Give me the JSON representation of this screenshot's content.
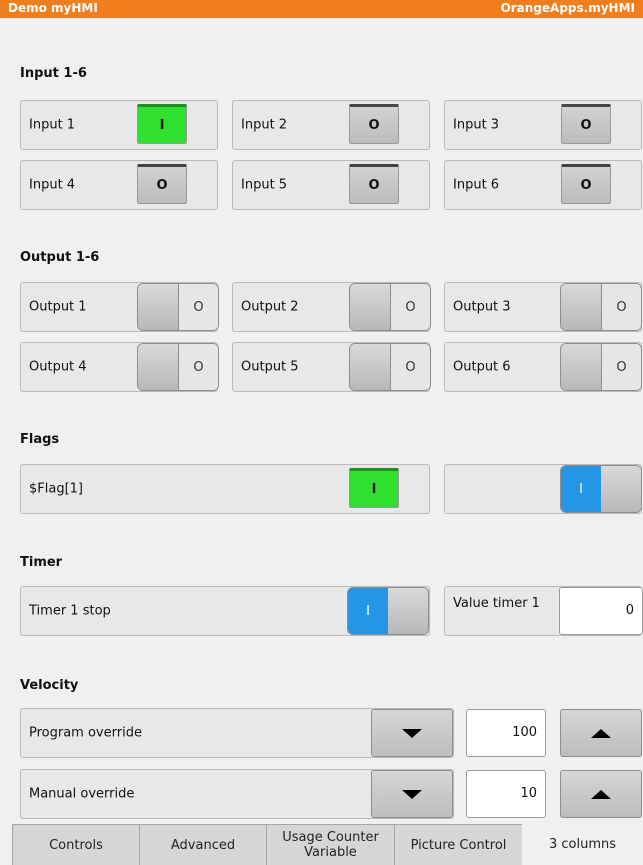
{
  "header": {
    "app_title": "Demo myHMI",
    "brand": "OrangeApps.myHMI"
  },
  "inputs": {
    "title": "Input 1-6",
    "items": [
      {
        "label": "Input 1",
        "state": "I"
      },
      {
        "label": "Input 2",
        "state": "O"
      },
      {
        "label": "Input 3",
        "state": "O"
      },
      {
        "label": "Input 4",
        "state": "O"
      },
      {
        "label": "Input 5",
        "state": "O"
      },
      {
        "label": "Input 6",
        "state": "O"
      }
    ]
  },
  "outputs": {
    "title": "Output 1-6",
    "items": [
      {
        "label": "Output 1",
        "toggle_text": "O"
      },
      {
        "label": "Output 2",
        "toggle_text": "O"
      },
      {
        "label": "Output 3",
        "toggle_text": "O"
      },
      {
        "label": "Output 4",
        "toggle_text": "O"
      },
      {
        "label": "Output 5",
        "toggle_text": "O"
      },
      {
        "label": "Output 6",
        "toggle_text": "O"
      }
    ]
  },
  "flags": {
    "title": "Flags",
    "flag1_label": "$Flag[1]",
    "flag1_state": "I",
    "switch_text": "I"
  },
  "timer": {
    "title": "Timer",
    "stop_label": "Timer 1 stop",
    "switch_text": "I",
    "value_label": "Value timer 1",
    "value": "0"
  },
  "velocity": {
    "title": "Velocity",
    "program_label": "Program override",
    "program_value": "100",
    "manual_label": "Manual override",
    "manual_value": "10"
  },
  "tabs": [
    {
      "label": "Controls"
    },
    {
      "label": "Advanced"
    },
    {
      "label": "Usage Counter Variable"
    },
    {
      "label": "Picture Control"
    },
    {
      "label": "3 columns"
    }
  ],
  "colors": {
    "header": "#f07d1e",
    "indicator_on": "#2fe02f",
    "switch_on": "#2596e6"
  }
}
